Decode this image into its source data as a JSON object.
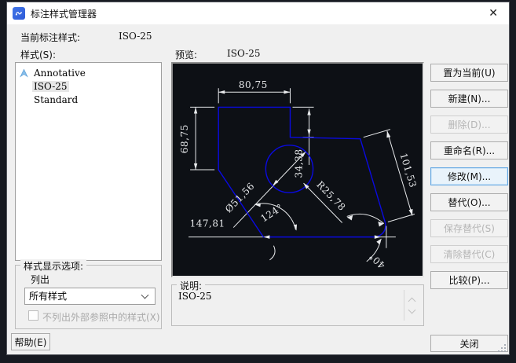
{
  "window": {
    "title": "标注样式管理器",
    "close_glyph": "✕"
  },
  "current_style": {
    "label": "当前标注样式:",
    "value": "ISO-25"
  },
  "styles": {
    "label": "样式(S):",
    "selected": "ISO-25",
    "items": [
      {
        "name": "Annotative"
      },
      {
        "name": "ISO-25"
      },
      {
        "name": "Standard"
      }
    ]
  },
  "preview": {
    "label": "预览:",
    "value": "ISO-25",
    "dims": {
      "top_width": "80,75",
      "left_height": "68,75",
      "notch_height": "34,38",
      "aligned_length": "101,53",
      "radius": "R25,78",
      "diameter": "Ø51,56",
      "angle_left": "124°",
      "bottom_width": "147,81",
      "angle_right": "40°"
    }
  },
  "description": {
    "label": "说明:",
    "text": "ISO-25"
  },
  "display_options": {
    "label": "样式显示选项:",
    "list_label": "列出",
    "selected_filter": "所有样式",
    "xref_checkbox_label": "不列出外部参照中的样式(X)",
    "xref_checkbox_checked": false
  },
  "side_buttons": [
    {
      "label": "置为当前(U)",
      "enabled": true
    },
    {
      "label": "新建(N)...",
      "enabled": true
    },
    {
      "label": "删除(D)...",
      "enabled": false
    },
    {
      "label": "重命名(R)...",
      "enabled": true
    },
    {
      "label": "修改(M)...",
      "enabled": true,
      "focused": true
    },
    {
      "label": "替代(O)...",
      "enabled": true
    },
    {
      "label": "保存替代(S)",
      "enabled": false
    },
    {
      "label": "清除替代(C)",
      "enabled": false
    },
    {
      "label": "比较(P)...",
      "enabled": true
    }
  ],
  "footer_buttons": {
    "help": "帮助(E)",
    "close": "关闭"
  },
  "colors": {
    "shape_blue": "#0a0ae0",
    "dim_white": "#e8eaec",
    "preview_bg": "#0d1015",
    "focus_border": "#61a6e3",
    "title_icon_blue": "#2e5bd7"
  }
}
